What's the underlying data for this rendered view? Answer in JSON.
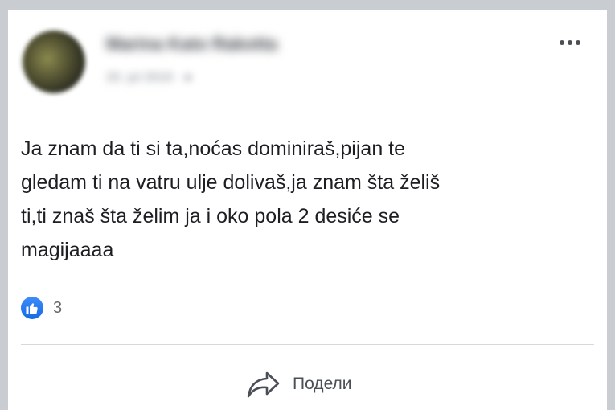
{
  "post": {
    "author_name": "Marina Kato Rakotta",
    "meta": "20. jul 2019 · ●",
    "text_lines": [
      "Ja znam da ti si ta,noćas dominiraš,pijan te",
      "gledam ti na vatru ulje dolivaš,ja znam šta želiš",
      "ti,ti znaš šta želim ja i oko pola 2 desiće se",
      "magijaaaa"
    ],
    "reactions": {
      "icon": "like-icon",
      "count": "3"
    },
    "actions": {
      "share_label": "Подели",
      "share_icon": "share-arrow-icon",
      "more_icon": "more-options-icon"
    }
  },
  "colors": {
    "like_blue": "#1877f2",
    "text": "#1c1e21",
    "secondary": "#65676b"
  }
}
